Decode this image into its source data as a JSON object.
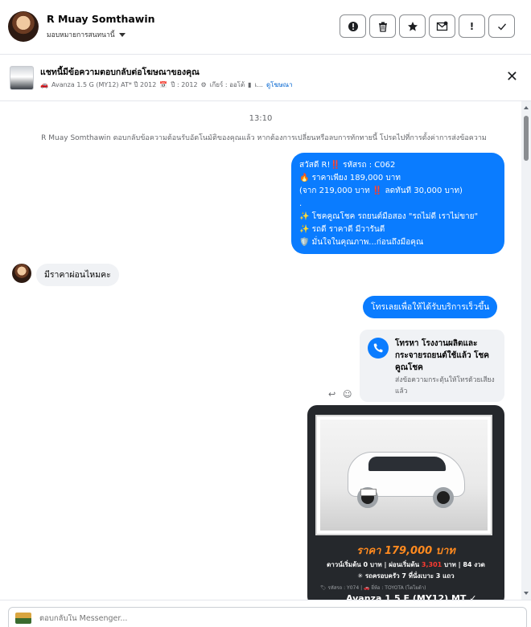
{
  "header": {
    "name": "R Muay Somthawin",
    "status": "มอบหมายการสนทนานี้",
    "buttons": [
      "!",
      "🗑",
      "★",
      "✉",
      "!",
      "✓"
    ]
  },
  "ad": {
    "title": "แชทนี้มีข้อความตอบกลับต่อโฆษณาของคุณ",
    "car": "Avanza 1.5 G (MY12) AT* ปี 2012",
    "year": "ปี : 2012",
    "gear": "เกียร์ : ออโต้",
    "more": "เ...",
    "link": "ดูโฆษณา"
  },
  "messages": {
    "time": "13:10",
    "system": "R Muay Somthawin ตอบกลับข้อความต้อนรับอัตโนมัติของคุณแล้ว หากต้องการเปลี่ยนหรือลบการทักทายนี้ โปรดไปที่การตั้งค่าการส่งข้อความ",
    "outgoing_1": [
      "สวัสดี R!‼️ รหัสรถ : C062",
      "🔥 ราคาเพียง 189,000 บาท",
      "(จาก 219,000 บาท ‼️ ลดทันที 30,000 บาท)",
      ".",
      "✨ โชคคูณโชค รถยนต์มือสอง \"รถไม่ดี เราไม่ขาย\"",
      "✨ รถดี ราคาดี มีวารันตี",
      "🛡️ มั่นใจในคุณภาพ...ก่อนถึงมือคุณ"
    ],
    "incoming_1": "มีราคาผ่อนไหมคะ",
    "outgoing_2": "โทรเลยเพื่อให้ได้รับบริการเร็วขึ้น",
    "call_card": {
      "title": "โทรหา โรงงานผลิตและกระจายรถยนต์ใช้แล้ว โชคคูณโชค",
      "subtitle": "ส่งข้อความกระตุ้นให้โทรด้วยเสียงแล้ว"
    },
    "photo_card": {
      "price": "ราคา 179,000 บาท",
      "line1_a": "ดาวน์เริ่มต้น 0 บาท | ผ่อนเริ่มต้น ",
      "line1_b": "3,301",
      "line1_c": " บาท | 84 งวด",
      "line2": "✳ รถครอบครัว 7 ที่นั่งเบาะ 3 แถว",
      "meta": "🏷 รหัสรถ : Y074  |  🚗 ยี่ห้อ : TOYOTA (โตโยต้า)",
      "model": "Avanza 1.5 E (MY12) MT ✓"
    }
  },
  "composer": {
    "placeholder": "ตอบกลับใน Messenger..."
  }
}
